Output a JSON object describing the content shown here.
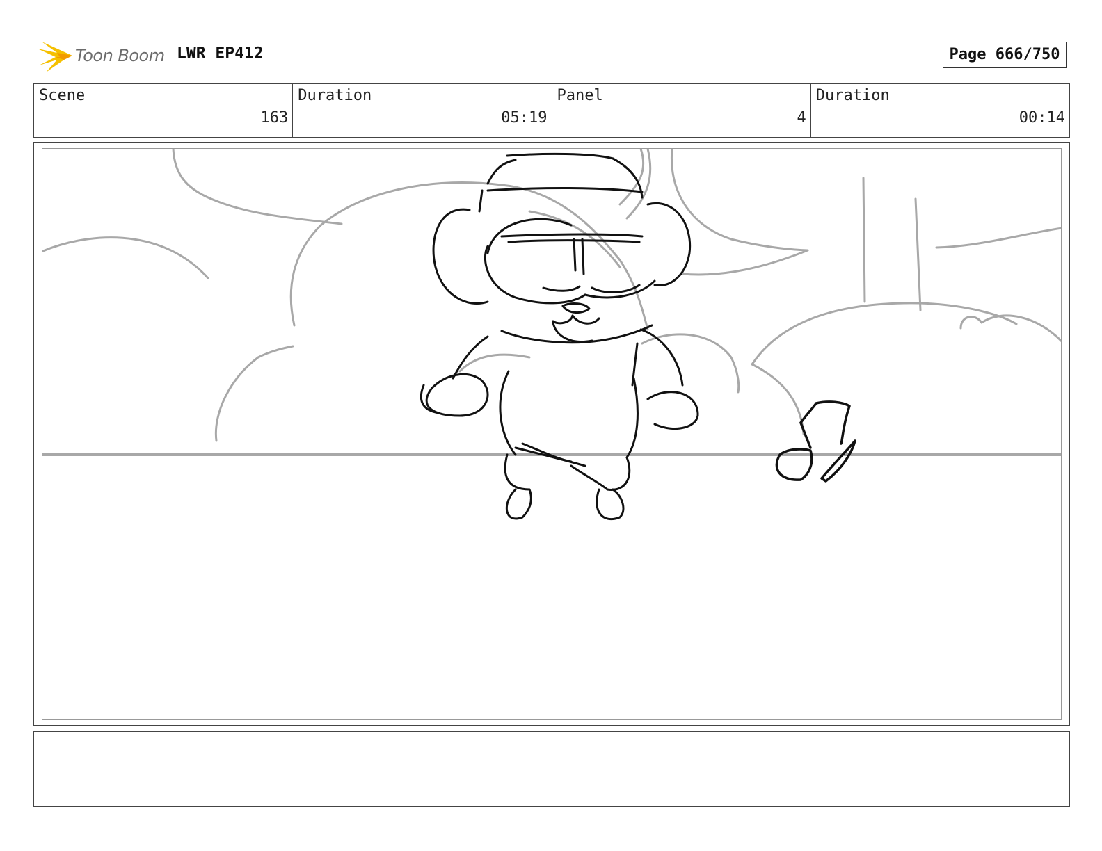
{
  "header": {
    "logo_text": "Toon Boom",
    "episode": "LWR EP412",
    "page_label": "Page 666/750"
  },
  "info": [
    {
      "label": "Scene",
      "value": "163"
    },
    {
      "label": "Duration",
      "value": "05:19"
    },
    {
      "label": "Panel",
      "value": "4"
    },
    {
      "label": "Duration",
      "value": "00:14"
    }
  ],
  "colors": {
    "logo_accent": "#f5c000",
    "sketch_line": "#111111",
    "background_line": "#a8a8a8"
  },
  "panel": {
    "description_icon": "storyboard-sketch-image"
  },
  "notes": {
    "text": ""
  }
}
